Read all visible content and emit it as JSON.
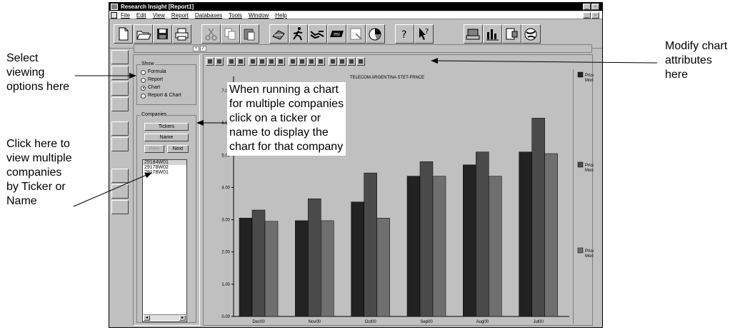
{
  "callouts": {
    "select_viewing": [
      "Select",
      "viewing",
      "options here"
    ],
    "multiple_companies": [
      "Click here to",
      "view multiple",
      "companies",
      "by Ticker or",
      "Name"
    ],
    "modify_chart": [
      "Modify chart",
      "attributes",
      "here"
    ],
    "chart_note": [
      "When running a chart",
      "for multiple companies",
      "click on a ticker or",
      "name to display the",
      "chart for that company"
    ]
  },
  "window": {
    "title": "Research Insight  [Report1]",
    "controls": [
      "_",
      "▫",
      "×"
    ],
    "menu": [
      "File",
      "Edit",
      "View",
      "Report",
      "Databases",
      "Tools",
      "Window",
      "Help"
    ]
  },
  "toolbar": {
    "icons": [
      "new-document-icon",
      "open-folder-icon",
      "save-icon",
      "print-icon",
      "cut-icon",
      "copy-icon",
      "paste-icon",
      "tools-icon",
      "run-icon",
      "handshake-icon",
      "mini-report-icon",
      "export-icon",
      "pie-chart-icon",
      "help-icon",
      "context-help-icon",
      "screen-icon",
      "bar-chart-icon",
      "report-icon",
      "globe-icon"
    ]
  },
  "show_group": {
    "title": "Show",
    "options": [
      {
        "label": "Formula",
        "selected": false
      },
      {
        "label": "Report",
        "selected": false
      },
      {
        "label": "Chart",
        "selected": true
      },
      {
        "label": "Report & Chart",
        "selected": false
      }
    ]
  },
  "companies_group": {
    "title": "Companies",
    "tickers_button": "Tickers",
    "name_button": "Name",
    "prev_button": "Prev",
    "next_button": "Next",
    "list": [
      "29184W01",
      "29178W02",
      "29178W01"
    ]
  },
  "chart_data": {
    "type": "bar",
    "title": "TELECOM ARGENTINA STET-FRNCE",
    "categories": [
      "Dec00",
      "Nov00",
      "Oct00",
      "Sep00",
      "Aug00",
      "Jul00"
    ],
    "series": [
      {
        "name": "Price Close - Monthly",
        "color": "#222222",
        "values": [
          3.05,
          2.97,
          3.55,
          4.35,
          4.7,
          5.1
        ]
      },
      {
        "name": "Price High - Monthly",
        "color": "#4a4a4a",
        "values": [
          3.3,
          3.65,
          4.45,
          4.8,
          5.1,
          6.15
        ]
      },
      {
        "name": "Price Low - Monthly",
        "color": "#6f6f6f",
        "values": [
          2.95,
          2.97,
          3.05,
          4.35,
          4.35,
          5.05
        ]
      }
    ],
    "yticks": [
      "0.00",
      "1.00",
      "2.00",
      "3.00",
      "4.00",
      "5.00",
      "6.00",
      "7.00"
    ],
    "ylim": [
      0,
      7
    ],
    "grid": false,
    "legend": "right"
  }
}
